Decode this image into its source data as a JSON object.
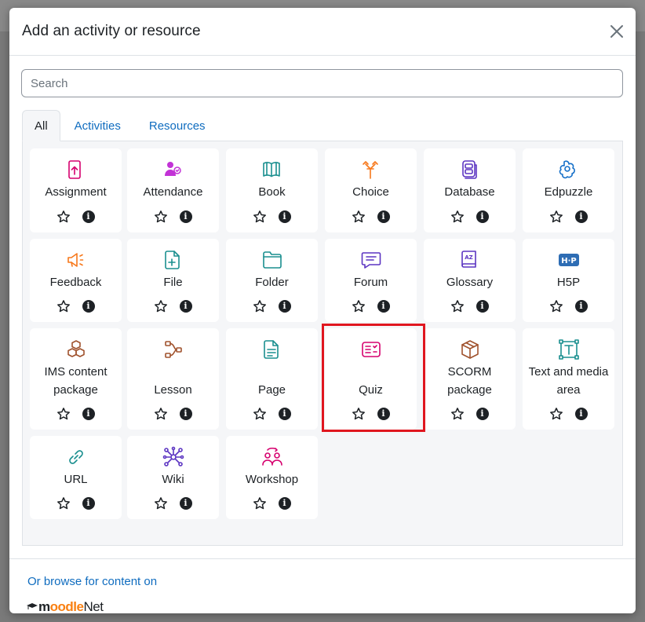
{
  "modal": {
    "title": "Add an activity or resource",
    "close_label": "×"
  },
  "search": {
    "placeholder": "Search",
    "value": ""
  },
  "tabs": [
    {
      "label": "All",
      "active": true
    },
    {
      "label": "Activities",
      "active": false
    },
    {
      "label": "Resources",
      "active": false
    }
  ],
  "items": [
    {
      "label": "Assignment",
      "icon": "assignment-icon",
      "color": "#d6006e"
    },
    {
      "label": "Attendance",
      "icon": "attendance-icon",
      "color": "#c232d6"
    },
    {
      "label": "Book",
      "icon": "book-icon",
      "color": "#1a8f8f"
    },
    {
      "label": "Choice",
      "icon": "choice-icon",
      "color": "#f7781b"
    },
    {
      "label": "Database",
      "icon": "database-icon",
      "color": "#5c35c2"
    },
    {
      "label": "Edpuzzle",
      "icon": "edpuzzle-icon",
      "color": "#1670c9"
    },
    {
      "label": "Feedback",
      "icon": "feedback-icon",
      "color": "#f7781b"
    },
    {
      "label": "File",
      "icon": "file-icon",
      "color": "#1a8f8f"
    },
    {
      "label": "Folder",
      "icon": "folder-icon",
      "color": "#1a8f8f"
    },
    {
      "label": "Forum",
      "icon": "forum-icon",
      "color": "#5c35c2"
    },
    {
      "label": "Glossary",
      "icon": "glossary-icon",
      "color": "#5c35c2"
    },
    {
      "label": "H5P",
      "icon": "h5p-icon",
      "color": "#2e6db4"
    },
    {
      "label": "IMS content package",
      "icon": "ims-package-icon",
      "color": "#a0522d"
    },
    {
      "label": "Lesson",
      "icon": "lesson-icon",
      "color": "#a0522d"
    },
    {
      "label": "Page",
      "icon": "page-icon",
      "color": "#1a8f8f"
    },
    {
      "label": "Quiz",
      "icon": "quiz-icon",
      "color": "#d6006e"
    },
    {
      "label": "SCORM package",
      "icon": "scorm-icon",
      "color": "#a0522d"
    },
    {
      "label": "Text and media area",
      "icon": "text-media-icon",
      "color": "#1a8f8f"
    },
    {
      "label": "URL",
      "icon": "url-icon",
      "color": "#1a8f8f"
    },
    {
      "label": "Wiki",
      "icon": "wiki-icon",
      "color": "#5c35c2"
    },
    {
      "label": "Workshop",
      "icon": "workshop-icon",
      "color": "#d6006e"
    }
  ],
  "footer": {
    "browse_text": "Or browse for content on",
    "logo_text_a": "m",
    "logo_text_b": "oodle",
    "logo_text_c": "Net"
  }
}
